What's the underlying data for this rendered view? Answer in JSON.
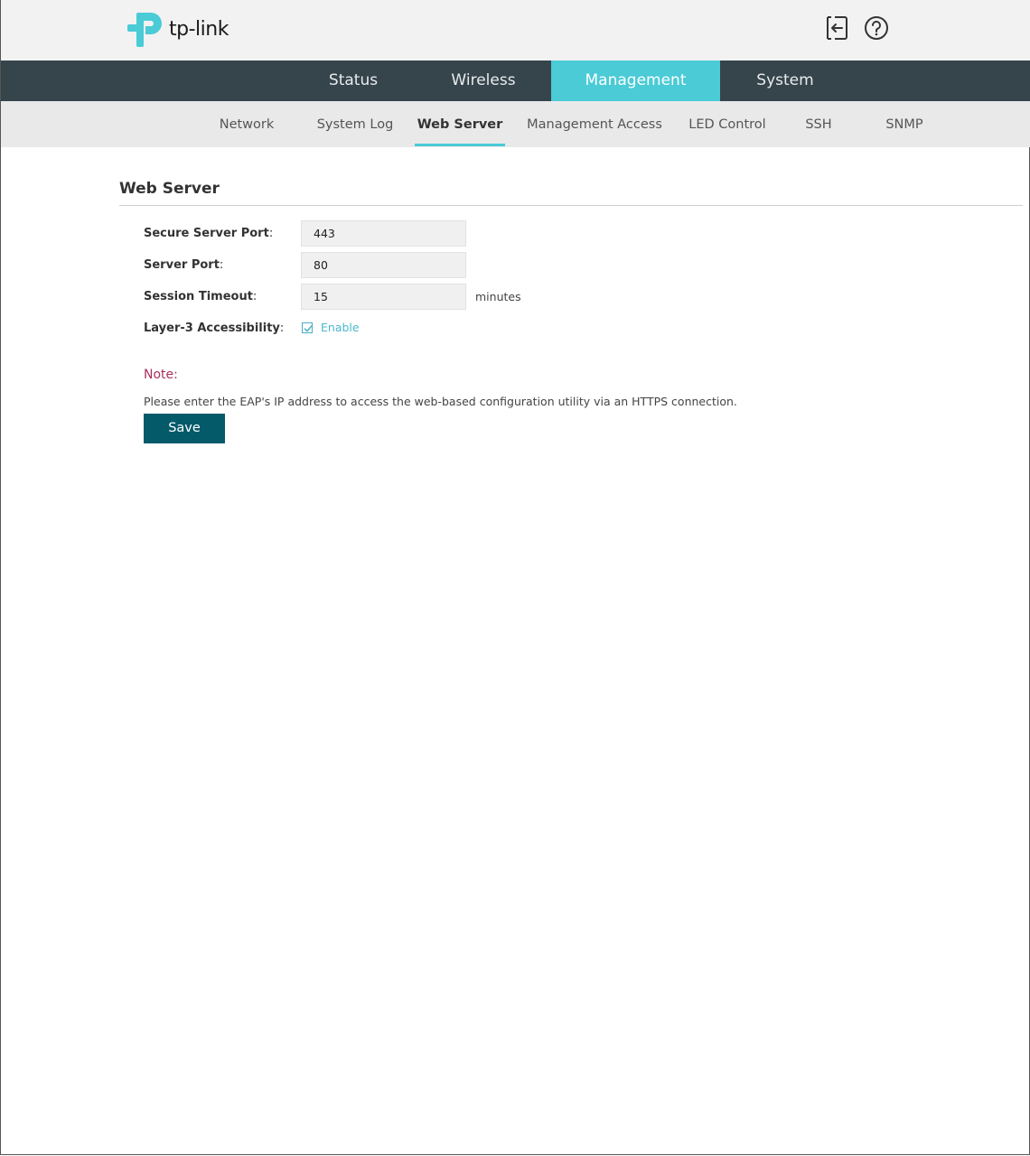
{
  "header": {
    "brand": "tp-link",
    "icons": {
      "logout": "logout-icon",
      "help": "help-icon"
    },
    "colors": {
      "logo": "#4acbd6",
      "nav_bg": "#36444c",
      "accent": "#4acbd6",
      "save_button": "#055a6a"
    }
  },
  "main_nav": {
    "tabs": [
      {
        "label": "Status",
        "active": false
      },
      {
        "label": "Wireless",
        "active": false
      },
      {
        "label": "Management",
        "active": true
      },
      {
        "label": "System",
        "active": false
      }
    ]
  },
  "sub_nav": {
    "tabs": [
      {
        "label": "Network",
        "active": false
      },
      {
        "label": "System Log",
        "active": false
      },
      {
        "label": "Web Server",
        "active": true
      },
      {
        "label": "Management Access",
        "active": false
      },
      {
        "label": "LED Control",
        "active": false
      },
      {
        "label": "SSH",
        "active": false
      },
      {
        "label": "SNMP",
        "active": false
      }
    ]
  },
  "page": {
    "title": "Web Server",
    "fields": {
      "secure_port": {
        "label": "Secure Server Port",
        "colon": ":",
        "value": "443"
      },
      "server_port": {
        "label": "Server Port",
        "colon": ":",
        "value": "80"
      },
      "session_timeout": {
        "label": "Session Timeout",
        "colon": ":",
        "value": "15",
        "unit": "minutes"
      },
      "layer3": {
        "label": "Layer-3 Accessibility",
        "colon": ":",
        "checked": true,
        "option_label": "Enable"
      }
    },
    "note": {
      "title": "Note:",
      "text": "Please enter the EAP's IP address to access the web-based configuration utility via an HTTPS connection."
    },
    "save_label": "Save"
  }
}
